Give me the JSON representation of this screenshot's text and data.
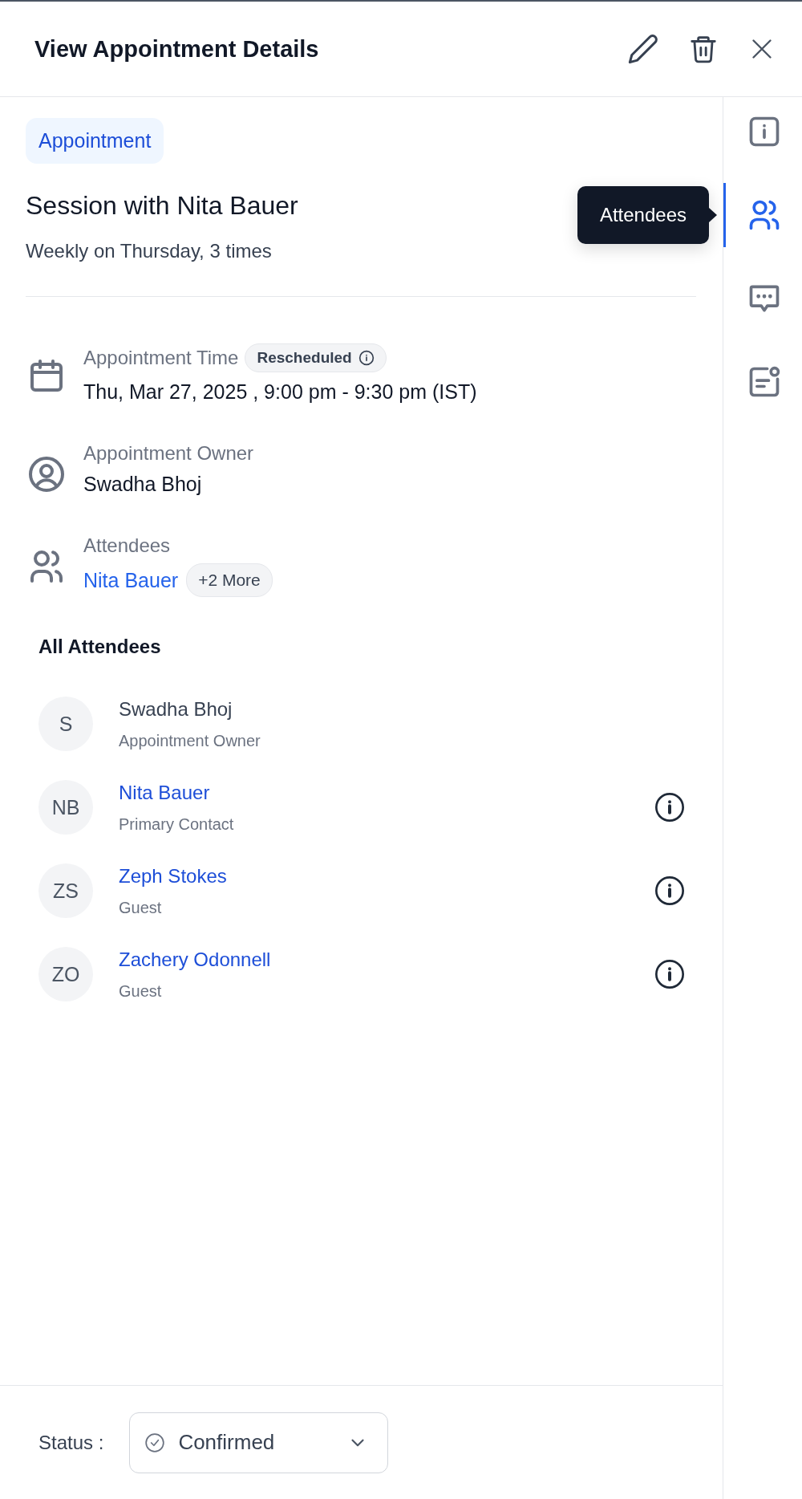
{
  "header": {
    "title": "View Appointment Details"
  },
  "tag": "Appointment",
  "title": "Session with Nita Bauer",
  "recurrence": "Weekly on Thursday, 3 times",
  "details": [
    {
      "kind": "time",
      "label": "Appointment Time",
      "badge": "Rescheduled",
      "value": "Thu, Mar 27, 2025 , 9:00 pm - 9:30 pm (IST)"
    },
    {
      "kind": "owner",
      "label": "Appointment Owner",
      "value": "Swadha Bhoj"
    },
    {
      "kind": "attendees",
      "label": "Attendees",
      "link": "Nita Bauer",
      "more": "+2 More"
    }
  ],
  "all_attendees": {
    "heading": "All Attendees",
    "people": [
      {
        "initials": "S",
        "name": "Swadha Bhoj",
        "role": "Appointment Owner",
        "linked": false
      },
      {
        "initials": "NB",
        "name": "Nita Bauer",
        "role": "Primary Contact",
        "linked": true
      },
      {
        "initials": "ZS",
        "name": "Zeph Stokes",
        "role": "Guest",
        "linked": true
      },
      {
        "initials": "ZO",
        "name": "Zachery Odonnell",
        "role": "Guest",
        "linked": true
      }
    ]
  },
  "sidebar": {
    "tooltip": "Attendees",
    "items": [
      {
        "kind": "info",
        "selected": false
      },
      {
        "kind": "attendees",
        "selected": true
      },
      {
        "kind": "comments",
        "selected": false
      },
      {
        "kind": "notes",
        "selected": false
      }
    ]
  },
  "footer": {
    "label": "Status :",
    "value": "Confirmed"
  }
}
